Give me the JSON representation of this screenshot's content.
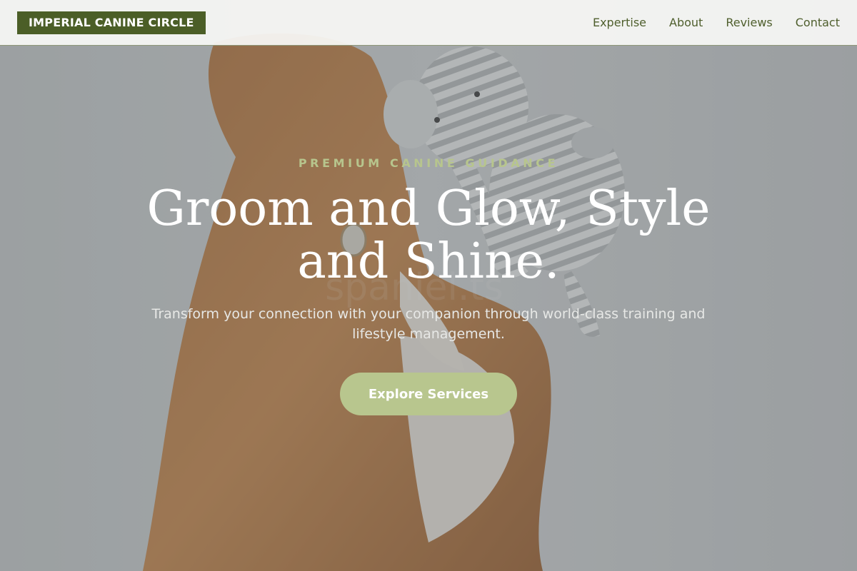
{
  "brand": {
    "logo_text": "IMPERIAL CANINE CIRCLE"
  },
  "nav": {
    "items": [
      {
        "label": "Expertise"
      },
      {
        "label": "About"
      },
      {
        "label": "Reviews"
      },
      {
        "label": "Contact"
      }
    ]
  },
  "hero": {
    "eyebrow": "PREMIUM CANINE GUIDANCE",
    "title": "Groom and Glow, Style and Shine.",
    "subtitle": "Transform your connection with your companion through world-class training and lifestyle management.",
    "cta_label": "Explore Services",
    "image_watermark": "spaniel.ts"
  },
  "colors": {
    "brand_green": "#4b5e27",
    "nav_text": "#4f5f2d",
    "accent_sage": "#b8c68e",
    "eyebrow_sage": "#b7c58d"
  }
}
